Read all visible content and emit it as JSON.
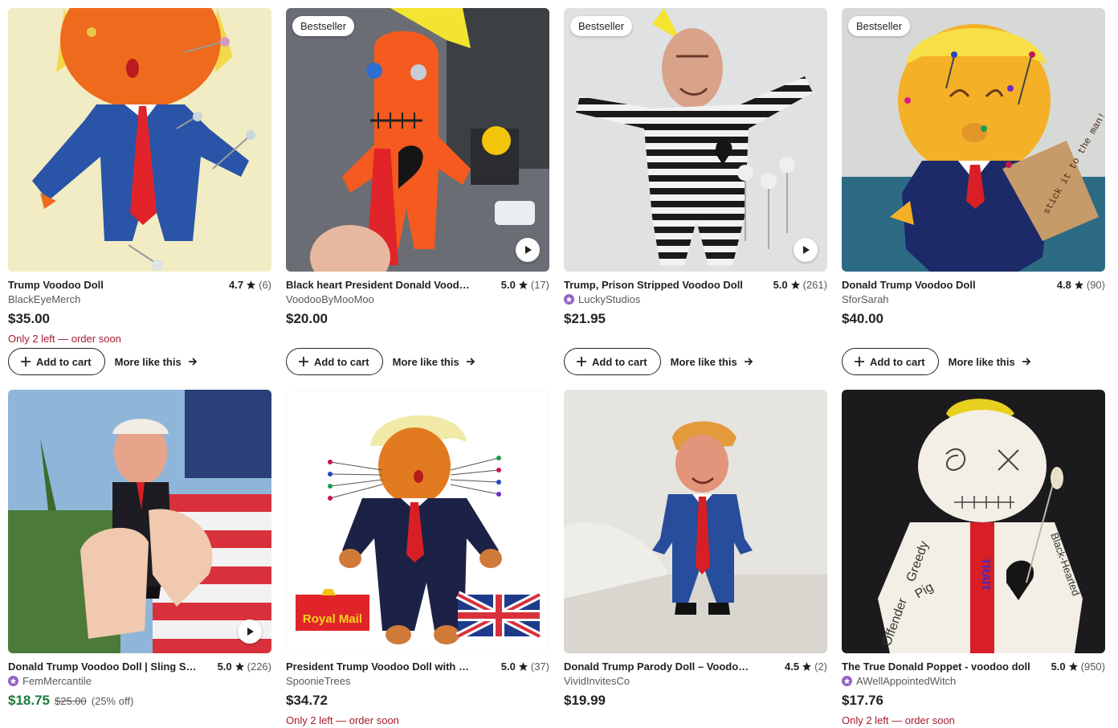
{
  "listings": [
    {
      "title": "Trump Voodoo Doll",
      "rating": "4.7",
      "count": "(6)",
      "shop": "BlackEyeMerch",
      "star_seller": false,
      "price": "$35.00",
      "stock": "Only 2 left — order soon",
      "badge": "",
      "video": false
    },
    {
      "title": "Black heart President Donald Voodoo Doll",
      "rating": "5.0",
      "count": "(17)",
      "shop": "VoodooByMooMoo",
      "star_seller": false,
      "price": "$20.00",
      "stock": "",
      "badge": "Bestseller",
      "video": true
    },
    {
      "title": "Trump, Prison Stripped Voodoo Doll",
      "rating": "5.0",
      "count": "(261)",
      "shop": "LuckyStudios",
      "star_seller": true,
      "price": "$21.95",
      "stock": "",
      "badge": "Bestseller",
      "video": true
    },
    {
      "title": "Donald Trump Voodoo Doll",
      "rating": "4.8",
      "count": "(90)",
      "shop": "SforSarah",
      "star_seller": false,
      "price": "$40.00",
      "stock": "",
      "badge": "Bestseller",
      "video": false
    },
    {
      "title": "Donald Trump Voodoo Doll | Sling Shot",
      "rating": "5.0",
      "count": "(226)",
      "shop": "FemMercantile",
      "star_seller": true,
      "price": "$18.75",
      "original_price": "$25.00",
      "discount": "(25% off)",
      "stock": "",
      "badge": "",
      "video": true
    },
    {
      "title": "President Trump Voodoo Doll with pins",
      "rating": "5.0",
      "count": "(37)",
      "shop": "SpoonieTrees",
      "star_seller": false,
      "price": "$34.72",
      "stock": "Only 2 left — order soon",
      "badge": "",
      "video": false
    },
    {
      "title": "Donald Trump Parody Doll – Voodoo Doll",
      "rating": "4.5",
      "count": "(2)",
      "shop": "VividInvitesCo",
      "star_seller": false,
      "price": "$19.99",
      "stock": "",
      "badge": "",
      "video": false
    },
    {
      "title": "The True Donald Poppet - voodoo doll",
      "rating": "5.0",
      "count": "(950)",
      "shop": "AWellAppointedWitch",
      "star_seller": true,
      "price": "$17.76",
      "stock": "Only 2 left — order soon",
      "badge": "",
      "video": false
    }
  ],
  "actions": {
    "add_to_cart": "Add to cart",
    "more_like_this": "More like this"
  },
  "image_text": {
    "tag": "stick it to the man!",
    "royal_mail": "Royal Mail",
    "poppet_words": [
      "Greedy",
      "Pig",
      "Offender",
      "Black-Hearted",
      "TRAIT"
    ]
  },
  "colors": {
    "sale_price": "#1e7b3a",
    "stock_warning": "#a61a2e",
    "star_seller": "#9560c8"
  }
}
